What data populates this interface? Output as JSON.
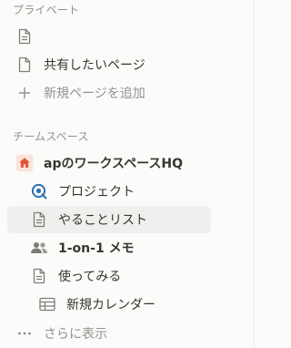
{
  "sections": {
    "private_label": "プライベート",
    "team_label": "チームスペース"
  },
  "private_items": [
    {
      "label": "",
      "icon": "page-icon"
    },
    {
      "label": "共有したいページ",
      "icon": "page-icon"
    },
    {
      "label": "新規ページを追加",
      "icon": "plus-icon"
    }
  ],
  "team_items": [
    {
      "label": "apのワークスペースHQ",
      "icon": "home-icon"
    },
    {
      "label": "プロジェクト",
      "icon": "target-icon"
    },
    {
      "label": "やることリスト",
      "icon": "page-icon"
    },
    {
      "label": "1-on-1 メモ",
      "icon": "people-icon"
    },
    {
      "label": "使ってみる",
      "icon": "page-icon"
    },
    {
      "label": "新規カレンダー",
      "icon": "table-icon"
    },
    {
      "label": "さらに表示",
      "icon": "more-icon"
    }
  ],
  "colors": {
    "home_accent": "#e0553a",
    "target_accent": "#2f6fb3"
  }
}
